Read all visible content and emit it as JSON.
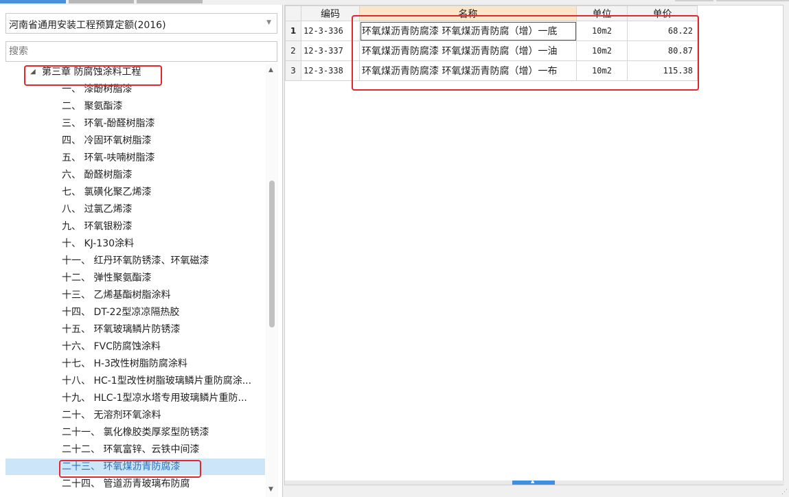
{
  "left": {
    "quota_select": {
      "value": "河南省通用安装工程预算定额(2016)"
    },
    "search": {
      "placeholder": "搜索"
    },
    "tree": {
      "root": "第三章 防腐蚀涂料工程",
      "items": [
        "一、 漆酚树脂漆",
        "二、 聚氨酯漆",
        "三、 环氧-酚醛树脂漆",
        "四、 冷固环氧树脂漆",
        "五、 环氧-呋喃树脂漆",
        "六、 酚醛树脂漆",
        "七、 氯磺化聚乙烯漆",
        "八、 过氯乙烯漆",
        "九、 环氧银粉漆",
        "十、 KJ-130涂料",
        "十一、 红丹环氧防锈漆、环氧磁漆",
        "十二、 弹性聚氨酯漆",
        "十三、 乙烯基酯树脂涂料",
        "十四、 DT-22型凉凉隔热胶",
        "十五、 环氧玻璃鳞片防锈漆",
        "十六、 FVC防腐蚀涂料",
        "十七、 H-3改性树脂防腐涂料",
        "十八、 HC-1型改性树脂玻璃鳞片重防腐涂...",
        "十九、 HLC-1型凉水塔专用玻璃鳞片重防...",
        "二十、 无溶剂环氧涂料",
        "二十一、 氯化橡胶类厚浆型防锈漆",
        "二十二、 环氧富锌、云铁中间漆",
        "二十三、 环氧煤沥青防腐漆",
        "二十四、 管道沥青玻璃布防腐"
      ],
      "selected_index": 22
    }
  },
  "grid": {
    "headers": {
      "code": "编码",
      "name": "名称",
      "unit": "单位",
      "price": "单价"
    },
    "rows": [
      {
        "num": "1",
        "code": "12-3-336",
        "name": "环氧煤沥青防腐漆 环氧煤沥青防腐（增）一底",
        "unit": "10m2",
        "price": "68.22"
      },
      {
        "num": "2",
        "code": "12-3-337",
        "name": "环氧煤沥青防腐漆 环氧煤沥青防腐（增）一油",
        "unit": "10m2",
        "price": "80.87"
      },
      {
        "num": "3",
        "code": "12-3-338",
        "name": "环氧煤沥青防腐漆 环氧煤沥青防腐（增）一布",
        "unit": "10m2",
        "price": "115.38"
      }
    ]
  },
  "icons": {
    "tree_toggle": "caret-down-icon",
    "dropdown": "chevron-down-icon"
  },
  "colors": {
    "selection_bg": "#cde6f7",
    "highlight_red": "#e3262b",
    "name_header_bg": "#fde6c8",
    "accent_blue": "#3f8ee0"
  }
}
